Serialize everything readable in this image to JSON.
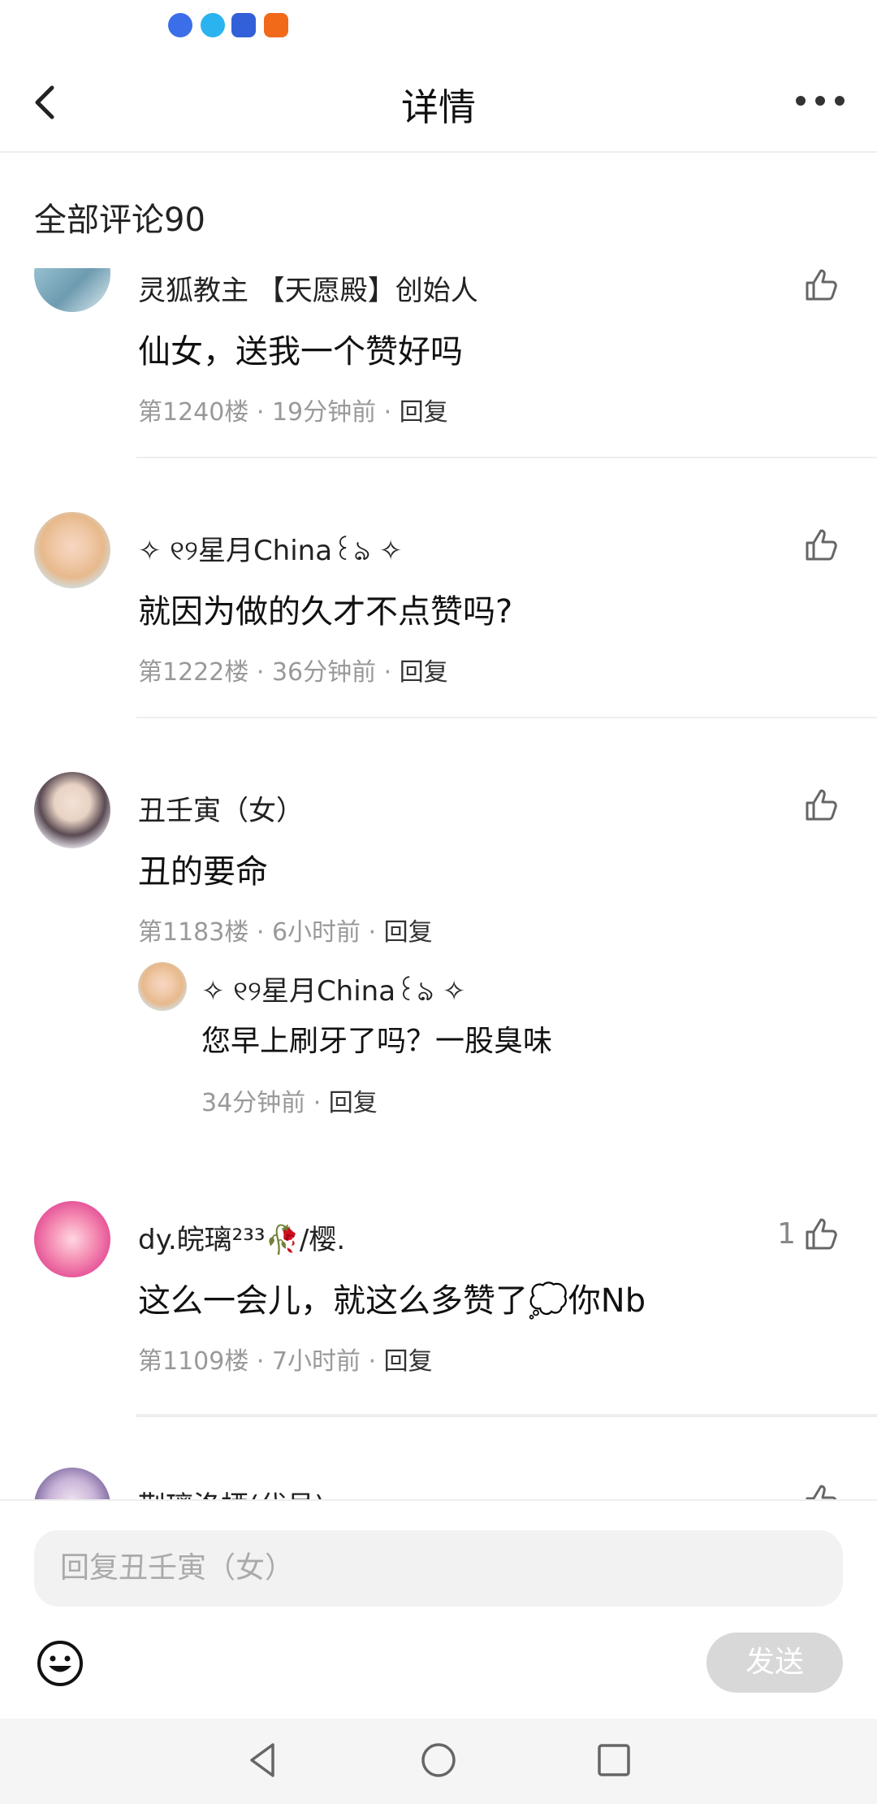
{
  "header": {
    "title": "详情"
  },
  "section": {
    "title": "全部评论90"
  },
  "comments": [
    {
      "name": "灵狐教主 【天愿殿】创始人",
      "text": "仙女，送我一个赞好吗",
      "meta": "第1240楼 · 19分钟前 · ",
      "reply_label": "回复",
      "likes": ""
    },
    {
      "name": "✧ ୧୨星月China꒰ঌ ✧",
      "text": "就因为做的久才不点赞吗?",
      "meta": "第1222楼 · 36分钟前 · ",
      "reply_label": "回复",
      "likes": ""
    },
    {
      "name": "丑壬寅（女）",
      "text": "丑的要命",
      "meta": "第1183楼 · 6小时前 · ",
      "reply_label": "回复",
      "likes": "",
      "sub_reply": {
        "name": "✧ ୧୨星月China꒰ঌ ✧",
        "text": "您早上刷牙了吗？一股臭味",
        "meta": "34分钟前 · ",
        "reply_label": "回复"
      }
    },
    {
      "name": "dy.皖璃²³³🥀/樱.",
      "text": "这么一会儿，就这么多赞了💭你Nb",
      "meta": "第1109楼 · 7小时前 · ",
      "reply_label": "回复",
      "likes": "1"
    },
    {
      "name": "荆璃洛栖(代号)",
      "text": "",
      "meta": "",
      "reply_label": "",
      "likes": ""
    }
  ],
  "input": {
    "placeholder": "回复丑壬寅（女）",
    "send_label": "发送"
  },
  "icons": {
    "back": "back-arrow-icon",
    "more": "more-dots-icon",
    "like": "thumbs-up-icon",
    "emoji": "smiley-icon",
    "nav_back": "nav-back-icon",
    "nav_home": "nav-home-icon",
    "nav_recent": "nav-recent-icon"
  },
  "colors": {
    "meta": "#999999",
    "send_disabled": "#d8d8d8",
    "input_bg": "#f2f2f2"
  }
}
